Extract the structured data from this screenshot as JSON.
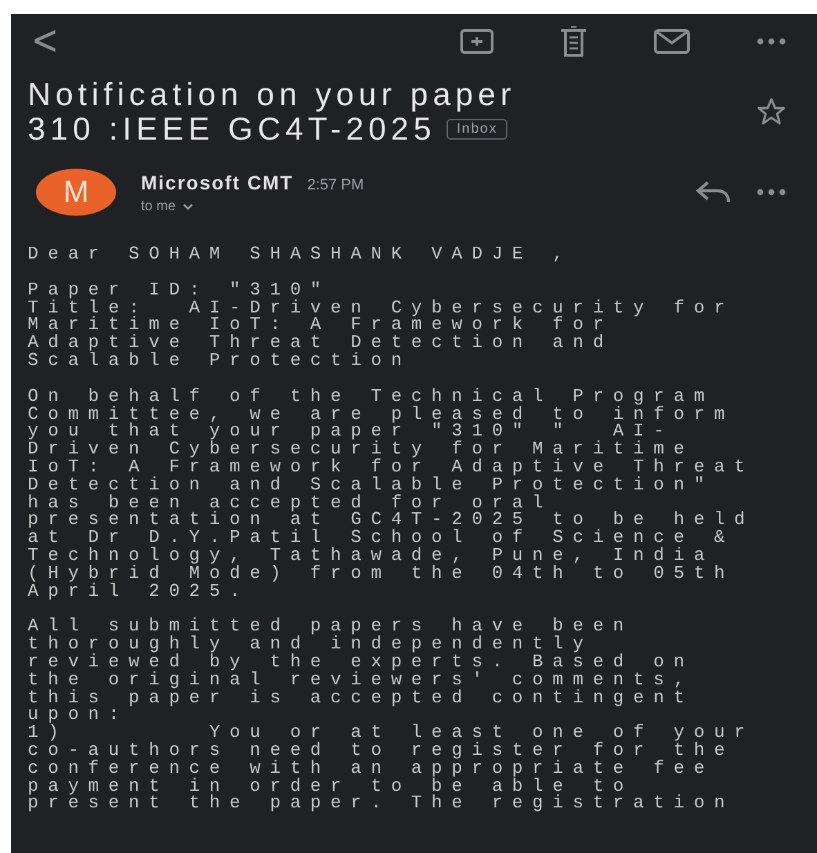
{
  "toolbar": {
    "back": "<"
  },
  "subject": {
    "lines": [
      "Notification on your paper",
      "310 :IEEE GC4T-2025"
    ],
    "label": "Inbox",
    "starred": false
  },
  "message": {
    "avatar_letter": "M",
    "sender": "Microsoft CMT",
    "time": "2:57 PM",
    "recipient": "to me"
  },
  "body": [
    "Dear SOHAM SHASHANK VADJE ,",
    "Paper ID: \"310\"\nTitle:  AI-Driven Cybersecurity for\nMaritime IoT: A Framework for\nAdaptive Threat Detection and\nScalable Protection",
    "On behalf of the Technical Program\nCommittee, we are pleased to inform\nyou that your paper \"310\" \"  AI-\nDriven Cybersecurity for Maritime\nIoT: A Framework for Adaptive Threat\nDetection and Scalable Protection\"\nhas been accepted for oral\npresentation at GC4T-2025 to be held\nat Dr D.Y.Patil School of Science &\nTechnology, Tathawade, Pune, India\n(Hybrid Mode) from the 04th to 05th\nApril 2025.",
    "All submitted papers have been\nthoroughly and independently\nreviewed by the experts. Based on\nthe original reviewers' comments,\nthis paper is accepted contingent\nupon:\n1)       You or at least one of your\nco-authors need to register for the\nconference with an appropriate fee\npayment in order to be able to\npresent the paper. The registration"
  ]
}
